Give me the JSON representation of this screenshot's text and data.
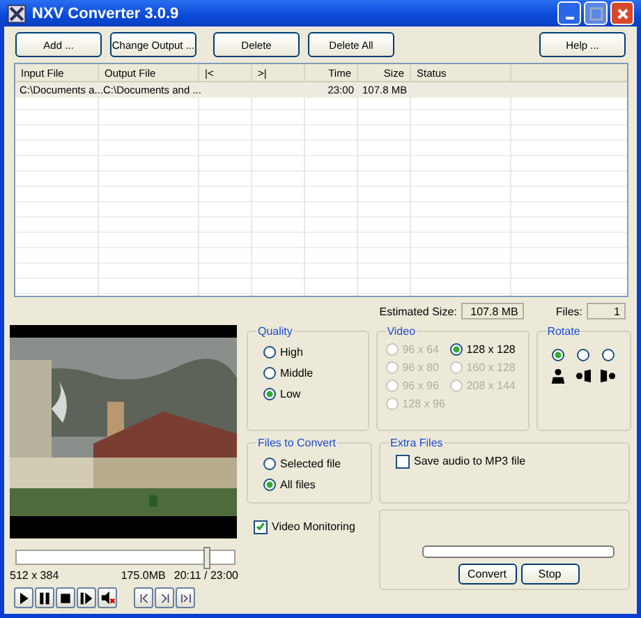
{
  "window": {
    "title": "NXV Converter 3.0.9"
  },
  "toolbar": [
    "Add ...",
    "Change Output ...",
    "Delete",
    "Delete All"
  ],
  "help_button": "Help ...",
  "table": {
    "columns": [
      "Input File",
      "Output File",
      "|<",
      ">|",
      "Time",
      "Size",
      "Status"
    ],
    "rows": [
      {
        "input_file": "C:\\Documents a...",
        "output_file": "C:\\Documents and ...",
        "time": "23:00",
        "size": "107.8 MB",
        "selected": true
      }
    ]
  },
  "estimated_size": {
    "label": "Estimated Size:",
    "value": "107.8 MB"
  },
  "files": {
    "label": "Files:",
    "value": "1"
  },
  "preview": {
    "kind": "picture",
    "seek": {
      "level": 0.87
    },
    "resolution": "512 x 384",
    "file_size": "175.0MB",
    "time": "20:11 / 23:00",
    "controls": [
      {
        "kind": "play"
      },
      {
        "kind": "pause"
      },
      {
        "kind": "stop"
      },
      {
        "kind": "next-frame"
      },
      {
        "kind": "mute"
      }
    ],
    "markers": [
      {
        "kind": "mark-in"
      },
      {
        "kind": "mark-out"
      },
      {
        "kind": "mark-both"
      }
    ]
  },
  "quality": {
    "title": "Quality",
    "options": [
      {
        "label": "High",
        "selected": false
      },
      {
        "label": "Middle",
        "selected": false
      },
      {
        "label": "Low",
        "selected": true
      }
    ]
  },
  "video": {
    "title": "Video",
    "options": [
      {
        "label": "96 x 64",
        "selected": false,
        "disabled": true
      },
      {
        "label": "128 x 128",
        "selected": true,
        "disabled": false
      },
      {
        "label": "96 x 80",
        "selected": false,
        "disabled": true
      },
      {
        "label": "160 x 128",
        "selected": false,
        "disabled": true
      },
      {
        "label": "96 x 96",
        "selected": false,
        "disabled": true
      },
      {
        "label": "208 x 144",
        "selected": false,
        "disabled": true
      },
      {
        "label": "128 x 96",
        "selected": false,
        "disabled": true
      }
    ]
  },
  "rotate": {
    "title": "Rotate",
    "options": [
      {
        "kind": "upright",
        "selected": true
      },
      {
        "kind": "left",
        "selected": false
      },
      {
        "kind": "right",
        "selected": false
      }
    ]
  },
  "files_to_convert": {
    "title": "Files to Convert",
    "options": [
      {
        "label": "Selected file",
        "selected": false
      },
      {
        "label": "All files",
        "selected": true
      }
    ]
  },
  "extra_files": {
    "title": "Extra Files",
    "checkbox": {
      "label": "Save audio to MP3 file",
      "checked": false
    }
  },
  "video_monitoring": {
    "label": "Video Monitoring",
    "checked": true
  },
  "convert": {
    "progress": {
      "level": 0
    },
    "buttons": [
      "Convert",
      "Stop"
    ]
  }
}
